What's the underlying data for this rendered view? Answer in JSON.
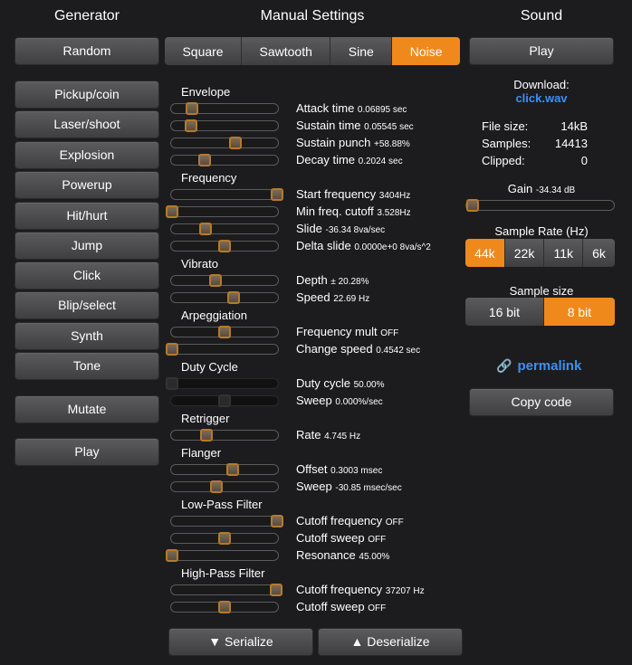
{
  "headers": {
    "generator": "Generator",
    "manual": "Manual Settings",
    "sound": "Sound"
  },
  "generator": {
    "random": "Random",
    "presets": [
      "Pickup/coin",
      "Laser/shoot",
      "Explosion",
      "Powerup",
      "Hit/hurt",
      "Jump",
      "Click",
      "Blip/select",
      "Synth",
      "Tone"
    ],
    "mutate": "Mutate",
    "play": "Play"
  },
  "waveforms": {
    "items": [
      "Square",
      "Sawtooth",
      "Sine",
      "Noise"
    ],
    "selected": "Noise"
  },
  "sections": {
    "envelope": "Envelope",
    "frequency": "Frequency",
    "vibrato": "Vibrato",
    "arpeggiation": "Arpeggiation",
    "duty": "Duty Cycle",
    "retrigger": "Retrigger",
    "flanger": "Flanger",
    "lowpass": "Low-Pass Filter",
    "highpass": "High-Pass Filter"
  },
  "params": {
    "attack": {
      "label": "Attack time",
      "value": "0.06895 sec",
      "level": 0.19,
      "disabled": false
    },
    "sustain": {
      "label": "Sustain time",
      "value": "0.05545 sec",
      "level": 0.18,
      "disabled": false
    },
    "punch": {
      "label": "Sustain punch",
      "value": "+58.88%",
      "level": 0.6,
      "disabled": false
    },
    "decay": {
      "label": "Decay time",
      "value": "0.2024 sec",
      "level": 0.31,
      "disabled": false
    },
    "start_freq": {
      "label": "Start frequency",
      "value": "3404Hz",
      "level": 1.0,
      "disabled": false
    },
    "min_freq": {
      "label": "Min freq. cutoff",
      "value": "3.528Hz",
      "level": 0.0,
      "disabled": false
    },
    "slide": {
      "label": "Slide",
      "value": "-36.34 8va/sec",
      "level": 0.32,
      "disabled": false
    },
    "delta_slide": {
      "label": "Delta slide",
      "value": "0.0000e+0 8va/s^2",
      "level": 0.5,
      "disabled": false
    },
    "vib_depth": {
      "label": "Depth",
      "value": "± 20.28%",
      "level": 0.41,
      "disabled": false
    },
    "vib_speed": {
      "label": "Speed",
      "value": "22.69 Hz",
      "level": 0.59,
      "disabled": false
    },
    "arp_mult": {
      "label": "Frequency mult",
      "value": "OFF",
      "level": 0.5,
      "disabled": false
    },
    "arp_speed": {
      "label": "Change speed",
      "value": "0.4542 sec",
      "level": 0.0,
      "disabled": false
    },
    "duty": {
      "label": "Duty cycle",
      "value": "50.00%",
      "level": 0.0,
      "disabled": true
    },
    "duty_sweep": {
      "label": "Sweep",
      "value": "0.000%/sec",
      "level": 0.5,
      "disabled": true
    },
    "retrig": {
      "label": "Rate",
      "value": "4.745 Hz",
      "level": 0.33,
      "disabled": false
    },
    "fl_offset": {
      "label": "Offset",
      "value": "0.3003 msec",
      "level": 0.58,
      "disabled": false
    },
    "fl_sweep": {
      "label": "Sweep",
      "value": "-30.85 msec/sec",
      "level": 0.42,
      "disabled": false
    },
    "lp_cut": {
      "label": "Cutoff frequency",
      "value": "OFF",
      "level": 1.0,
      "disabled": false
    },
    "lp_sweep": {
      "label": "Cutoff sweep",
      "value": "OFF",
      "level": 0.5,
      "disabled": false
    },
    "lp_res": {
      "label": "Resonance",
      "value": "45.00%",
      "level": 0.0,
      "disabled": false
    },
    "hp_cut": {
      "label": "Cutoff frequency",
      "value": "37207 Hz",
      "level": 0.99,
      "disabled": false
    },
    "hp_sweep": {
      "label": "Cutoff sweep",
      "value": "OFF",
      "level": 0.5,
      "disabled": false
    }
  },
  "serialize": "▼ Serialize",
  "deserialize": "▲ Deserialize",
  "sound": {
    "play": "Play",
    "download_label": "Download:",
    "download_file": "click.wav",
    "file_size_label": "File size:",
    "file_size": "14kB",
    "samples_label": "Samples:",
    "samples": "14413",
    "clipped_label": "Clipped:",
    "clipped": "0",
    "gain_label": "Gain",
    "gain_value": "-34.34 dB",
    "gain_level": 0.0,
    "sample_rate_label": "Sample Rate (Hz)",
    "sample_rates": [
      "44k",
      "22k",
      "11k",
      "6k"
    ],
    "sample_rate_selected": "44k",
    "sample_size_label": "Sample size",
    "sample_sizes": [
      "16 bit",
      "8 bit"
    ],
    "sample_size_selected": "8 bit",
    "permalink": "permalink",
    "copy_code": "Copy code"
  },
  "colors": {
    "accent": "#f0891c",
    "link": "#3e8fef",
    "background": "#1c1c1e"
  }
}
